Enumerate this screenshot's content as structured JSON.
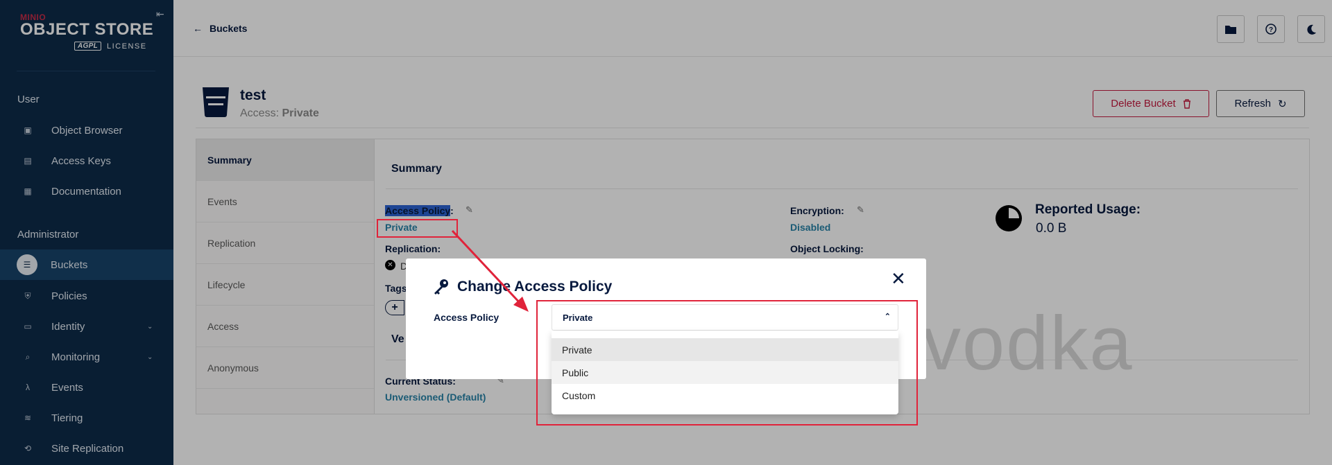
{
  "brand": {
    "vendor": "MINIO",
    "product": "OBJECT STORE",
    "license_badge": "AGPL",
    "license_text": "LICENSE"
  },
  "sidebar": {
    "user_section": "User",
    "user_items": [
      {
        "label": "Object Browser",
        "icon": "object-browser-icon"
      },
      {
        "label": "Access Keys",
        "icon": "access-keys-icon"
      },
      {
        "label": "Documentation",
        "icon": "documentation-icon"
      }
    ],
    "admin_section": "Administrator",
    "admin_items": [
      {
        "label": "Buckets",
        "icon": "buckets-icon",
        "active": true
      },
      {
        "label": "Policies",
        "icon": "policies-icon"
      },
      {
        "label": "Identity",
        "icon": "identity-icon",
        "expandable": true
      },
      {
        "label": "Monitoring",
        "icon": "monitoring-icon",
        "expandable": true
      },
      {
        "label": "Events",
        "icon": "lambda-icon"
      },
      {
        "label": "Tiering",
        "icon": "tiering-icon"
      },
      {
        "label": "Site Replication",
        "icon": "site-replication-icon"
      }
    ]
  },
  "header": {
    "back_label": "Buckets",
    "icons": [
      "folder-icon",
      "help-icon",
      "dark-mode-icon"
    ]
  },
  "bucket": {
    "name": "test",
    "access_label": "Access:",
    "access_value": "Private",
    "delete_label": "Delete Bucket",
    "refresh_label": "Refresh"
  },
  "tabs": [
    "Summary",
    "Events",
    "Replication",
    "Lifecycle",
    "Access",
    "Anonymous"
  ],
  "summary": {
    "title": "Summary",
    "access_policy_label": "Access Policy",
    "access_policy_colon": ":",
    "access_policy_value": "Private",
    "replication_label": "Replication:",
    "replication_value_partial": "D",
    "tags_label": "Tags",
    "tags_add": "+",
    "encryption_label": "Encryption:",
    "encryption_value": "Disabled",
    "object_locking_label": "Object Locking:",
    "usage_label": "Reported Usage:",
    "usage_value": "0.0 B",
    "versioning_label_partial": "Ve",
    "current_status_label": "Current Status:",
    "current_status_value": "Unversioned (Default)"
  },
  "watermark": "vodka",
  "modal": {
    "title": "Change Access Policy",
    "field_label": "Access Policy",
    "selected": "Private",
    "options": [
      "Private",
      "Public",
      "Custom"
    ],
    "close_icon": "close-icon",
    "title_icon": "key-icon"
  },
  "colors": {
    "sidebar_bg": "#0d2b4a",
    "link": "#2783a8",
    "danger": "#c51b3f",
    "annotation": "#e0233a"
  }
}
